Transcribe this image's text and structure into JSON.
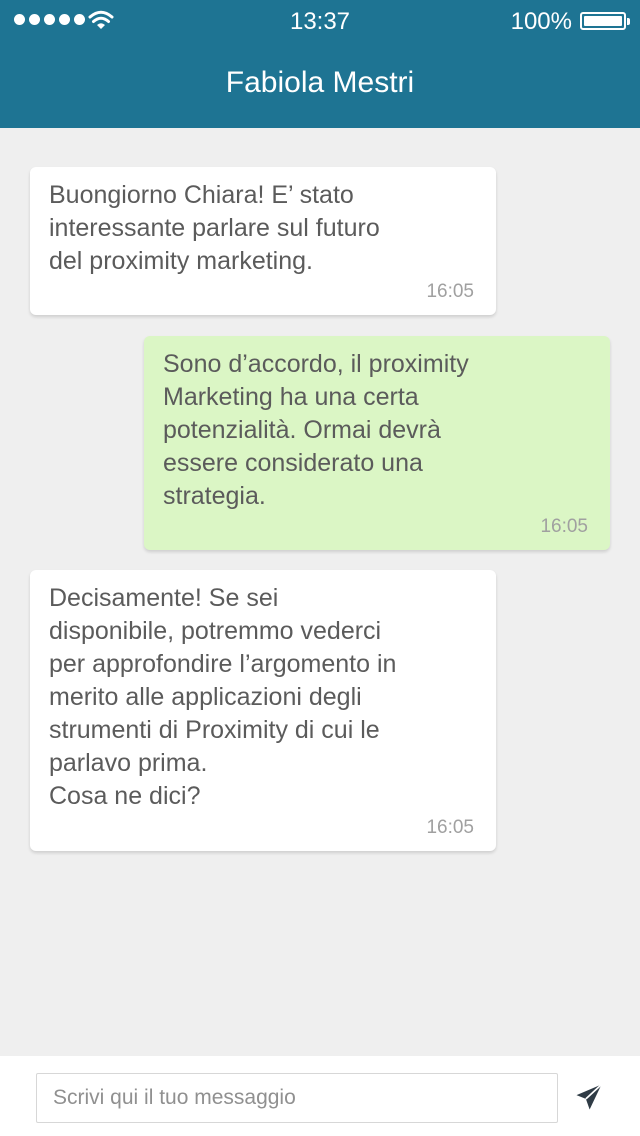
{
  "status_bar": {
    "time": "13:37",
    "battery_percent": "100%",
    "signal_bars": 5,
    "icons": [
      "signal-dots-icon",
      "wifi-icon",
      "battery-icon"
    ]
  },
  "header": {
    "title": "Fabiola Mestri",
    "background_color": "#1e7493"
  },
  "messages": [
    {
      "direction": "incoming",
      "text": "Buongiorno Chiara! E’ stato\ninteressante parlare sul futuro\ndel proximity marketing.",
      "time": "16:05"
    },
    {
      "direction": "outgoing",
      "text": "Sono d’accordo, il proximity\nMarketing ha una certa\npotenzialità. Ormai devrà\nessere considerato una\nstrategia.",
      "time": "16:05"
    },
    {
      "direction": "incoming",
      "text": "Decisamente! Se sei\ndisponibile, potremmo vederci\nper approfondire l’argomento in\nmerito alle applicazioni degli\nstrumenti di Proximity di cui le\nparlavo prima.\nCosa ne dici?",
      "time": "16:05"
    }
  ],
  "composer": {
    "placeholder": "Scrivi qui il tuo messaggio",
    "value": "",
    "send_icon": "send-icon"
  },
  "colors": {
    "incoming_bubble": "#ffffff",
    "outgoing_bubble": "#dbf6c5",
    "chat_background": "#efefef"
  }
}
